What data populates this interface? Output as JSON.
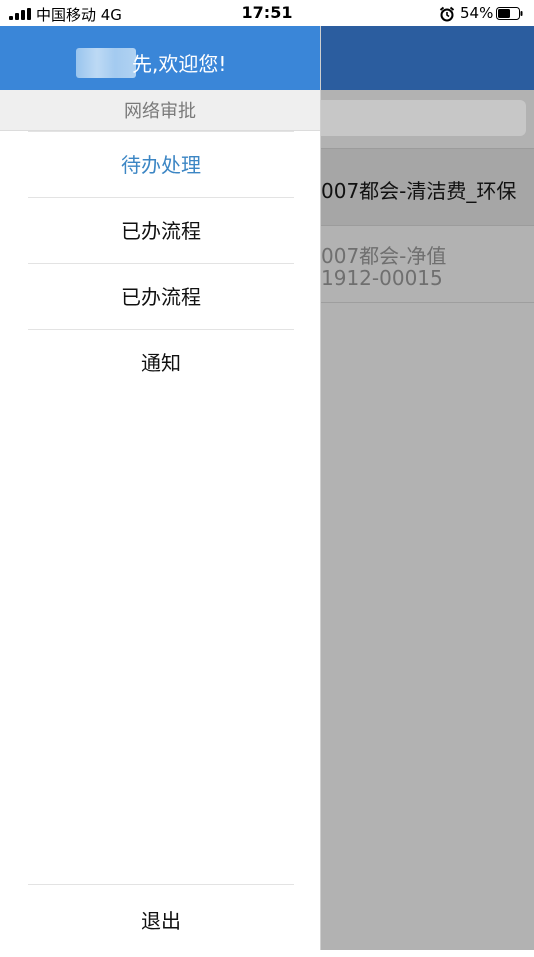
{
  "status_bar": {
    "carrier": "中国移动  4G",
    "time": "17:51",
    "battery": "54%"
  },
  "drawer": {
    "welcome": "先,欢迎您!",
    "section_title": "网络审批",
    "menu_items": [
      {
        "label": "待办处理",
        "active": true
      },
      {
        "label": "已办流程"
      },
      {
        "label": "已办流程"
      },
      {
        "label": "通知"
      }
    ],
    "logout": "退出"
  },
  "background": {
    "rows": [
      {
        "line1": "007都会-清洁费_环保"
      },
      {
        "line1": "007都会-净值",
        "line2": "1912-00015"
      }
    ]
  },
  "colors": {
    "drawer_header": "#3a86d8",
    "app_header": "#2b5d9f",
    "active_menu": "#3c86c4",
    "overlay": "#b2b2b2"
  }
}
